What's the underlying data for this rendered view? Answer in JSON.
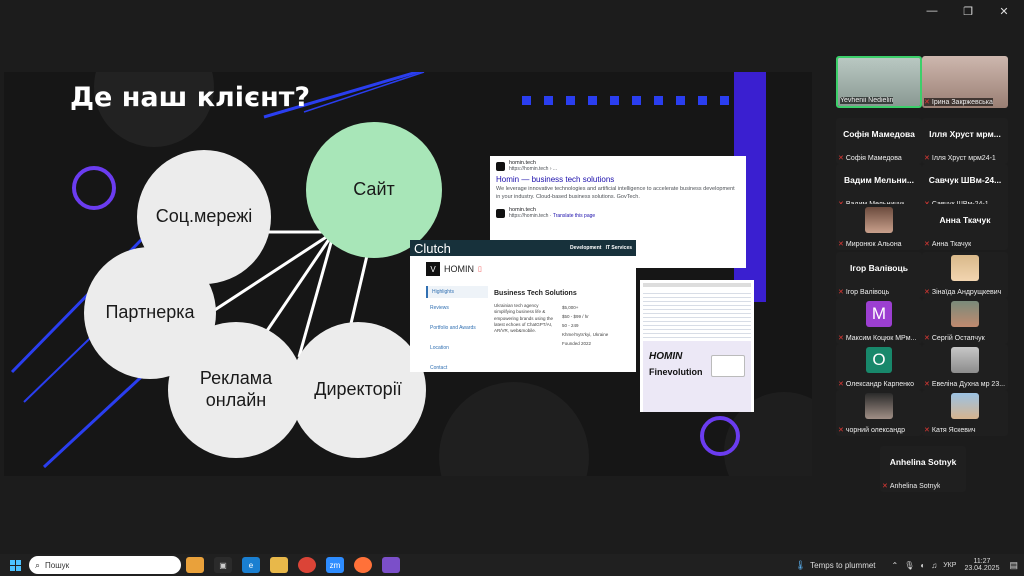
{
  "window": {
    "minimize": "—",
    "maximize": "❐",
    "close": "✕"
  },
  "slide": {
    "title": "Де наш клієнт?",
    "bubbles": {
      "site": "Сайт",
      "social": "Соц.мережі",
      "partner": "Партнерка",
      "ads": "Реклама онлайн",
      "directories": "Директорії"
    },
    "google_card": {
      "site_name": "homin.tech",
      "site_url": "https://homin.tech › ...",
      "result_title": "Homin — business tech solutions",
      "result_desc": "We leverage innovative technologies and artificial intelligence to accelerate business development in your industry. Cloud-based business solutions. GovTech.",
      "site_name_2": "homin.tech",
      "site_url_2": "https://homin.tech",
      "translate": "Translate this page"
    },
    "clutch_card": {
      "brand": "Clutch",
      "nav_1": "Development",
      "nav_2": "IT Services",
      "company": "HOMIN",
      "menu": [
        "Highlights",
        "Reviews",
        "Portfolio and Awards",
        "Location",
        "Contact"
      ],
      "section": "Business Tech Solutions",
      "desc": "Ukrainian tech agency simplifying business life & empowering brands using the latest echoes of ChatGPT/AI, AR/VR, web&mobile.",
      "facts": [
        "$5,000+",
        "$50 - $99 / hr",
        "50 - 249",
        "Khmel'nyts'kyi, Ukraine",
        "Founded 2022"
      ]
    },
    "post_card": {
      "logo": "HOMIN",
      "partner": "Finevolution"
    }
  },
  "participants": [
    {
      "name": "Yevhenii Nedielin",
      "type": "video"
    },
    {
      "name": "Ірина Закржевська",
      "type": "video"
    },
    {
      "name": "Софія Мамедова",
      "label": "Софія Мамедова",
      "type": "name"
    },
    {
      "name": "Ілля Хруст мрм24-1",
      "label": "Ілля Хруст мрм...",
      "type": "name"
    },
    {
      "name": "Вадим Мельничук",
      "label": "Вадим Мельни...",
      "type": "name"
    },
    {
      "name": "Савчук ШВм-24-1",
      "label": "Савчук ШВм-24...",
      "type": "name"
    },
    {
      "name": "Миронюк Альона",
      "type": "photo"
    },
    {
      "name": "Анна Ткачук",
      "label": "Анна Ткачук",
      "type": "name"
    },
    {
      "name": "Ігор Валівоць",
      "label": "Ігор Валівоць",
      "type": "name"
    },
    {
      "name": "Зінаїда Андрущкевич",
      "type": "photo"
    },
    {
      "name": "Максим Коцюк МРм...",
      "type": "letter",
      "letter": "M"
    },
    {
      "name": "Сергій Остапчук",
      "type": "photo"
    },
    {
      "name": "Олександр Карпенко",
      "type": "letter",
      "letter": "O"
    },
    {
      "name": "Евеліна Духнa мр 23...",
      "type": "photo"
    },
    {
      "name": "чорний олександр",
      "type": "photo"
    },
    {
      "name": "Катя Яскевич",
      "type": "photo"
    },
    {
      "name": "Anhelina Sotnyk",
      "label": "Anhelina Sotnyk",
      "type": "name"
    }
  ],
  "taskbar": {
    "search_placeholder": "Пошук",
    "weather": "Temps to plummet",
    "lang": "УКР",
    "time": "11:27",
    "date": "23.04.2025"
  },
  "colors": {
    "accent_green": "#a8e6b8",
    "slide_blue": "#2a3ef0",
    "slide_purple": "#6b3cf0",
    "clutch_dark": "#17313b"
  }
}
